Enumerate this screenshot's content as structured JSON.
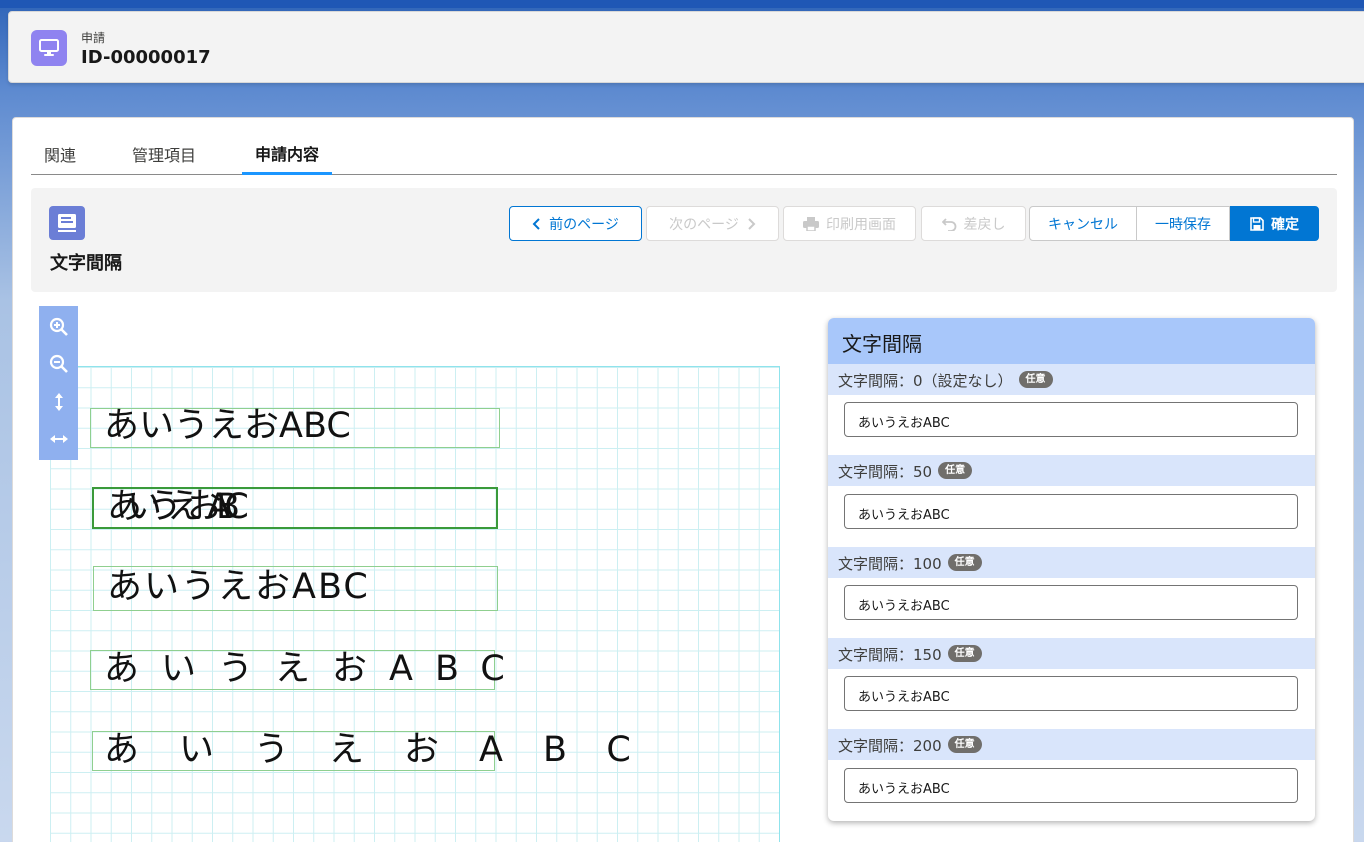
{
  "record": {
    "type_label": "申請",
    "id": "ID-00000017",
    "icon": "desktop-icon"
  },
  "tabs": [
    {
      "label": "関連"
    },
    {
      "label": "管理項目"
    },
    {
      "label": "申請内容",
      "active": true
    }
  ],
  "form": {
    "title": "文字間隔",
    "icon": "form-icon"
  },
  "toolbar": {
    "prev_label": "前のページ",
    "next_label": "次のページ",
    "print_label": "印刷用画面",
    "return_label": "差戻し",
    "cancel_label": "キャンセル",
    "save_temp_label": "一時保存",
    "confirm_label": "確定"
  },
  "canvas": {
    "zoom_tools": [
      "zoom-in-icon",
      "zoom-out-icon",
      "fit-height-icon",
      "fit-width-icon"
    ],
    "samples": [
      "あいうえおABC",
      "あいうえおABC",
      "あいうえおABC",
      "あいうえおABC",
      "あいうえおABC"
    ]
  },
  "panel": {
    "title": "文字間隔",
    "fields": [
      {
        "label": "文字間隔：0（設定なし）",
        "badge": "任意",
        "value": "あいうえおABC"
      },
      {
        "label": "文字間隔：50",
        "badge": "任意",
        "value": "あいうえおABC"
      },
      {
        "label": "文字間隔：100",
        "badge": "任意",
        "value": "あいうえおABC"
      },
      {
        "label": "文字間隔：150",
        "badge": "任意",
        "value": "あいうえおABC"
      },
      {
        "label": "文字間隔：200",
        "badge": "任意",
        "value": "あいうえおABC"
      }
    ]
  },
  "colors": {
    "brand": "#0176d3",
    "record_icon": "#8f83f0",
    "panel_header": "#a8c7fa",
    "field_label_bg": "#d9e5fb"
  }
}
